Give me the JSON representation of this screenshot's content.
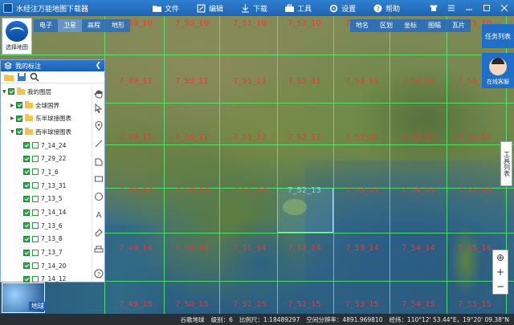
{
  "titlebar": {
    "title": "水经注万能地图下载器",
    "menu": [
      "文件",
      "编辑",
      "下载",
      "工具",
      "设置",
      "帮助"
    ]
  },
  "map_type": {
    "label": "选择地图",
    "left_tabs": [
      "电子",
      "卫星",
      "高程",
      "地形"
    ],
    "active_left_tab": "卫星",
    "right_tabs": [
      "地名",
      "区划",
      "坐标",
      "图幅",
      "瓦片"
    ]
  },
  "right_panel": {
    "task_list": "任务列表",
    "online_service": "在线客服",
    "tool_list": "工具列表"
  },
  "layer_panel": {
    "title": "我的标注",
    "tree": [
      {
        "label": "我的图层",
        "level": 0
      },
      {
        "label": "全球国界",
        "level": 1
      },
      {
        "label": "东半球接图表",
        "level": 1
      },
      {
        "label": "西半球接图表",
        "level": 1
      },
      {
        "label": "7_14_24",
        "level": 2
      },
      {
        "label": "7_29_22",
        "level": 2
      },
      {
        "label": "7_1_6",
        "level": 2
      },
      {
        "label": "7_13_31",
        "level": 2
      },
      {
        "label": "7_13_5",
        "level": 2
      },
      {
        "label": "7_14_14",
        "level": 2
      },
      {
        "label": "7_13_6",
        "level": 2
      },
      {
        "label": "7_13_8",
        "level": 2
      },
      {
        "label": "7_13_7",
        "level": 2
      },
      {
        "label": "7_14_20",
        "level": 2
      },
      {
        "label": "7_14_12",
        "level": 2
      }
    ],
    "earth_label": "地球"
  },
  "tiles": [
    "7_49_10",
    "7_50_10",
    "7_51_10",
    "7_52_10",
    "7_53_10",
    "7_54_10",
    "7_55_10",
    "7_49_11",
    "7_50_11",
    "7_51_11",
    "7_52_11",
    "7_53_11",
    "7_54_11",
    "7_55_11",
    "7_49_12",
    "7_50_12",
    "7_51_12",
    "7_52_12",
    "7_53_12",
    "7_54_12",
    "7_55_12",
    "7_49_13",
    "7_50_13",
    "7_51_13",
    "7_52_13",
    "7_53_13",
    "7_54_13",
    "7_55_13",
    "7_49_14",
    "7_50_14",
    "7_51_14",
    "7_52_14",
    "7_53_14",
    "7_54_14",
    "7_55_14",
    "7_49_15",
    "7_50_15",
    "7_51_15",
    "7_52_15",
    "7_53_15",
    "7_54_15",
    "7_55_15"
  ],
  "selected_tile": "7_52_13",
  "status": {
    "source": "谷歌地球",
    "level": "级别：6",
    "scale": "比例尺：1:18489297",
    "resolution": "空间分辨率：4891.969810",
    "coords": "经纬：110°12' 53.44\"E，19°20' 09.38\"N"
  }
}
